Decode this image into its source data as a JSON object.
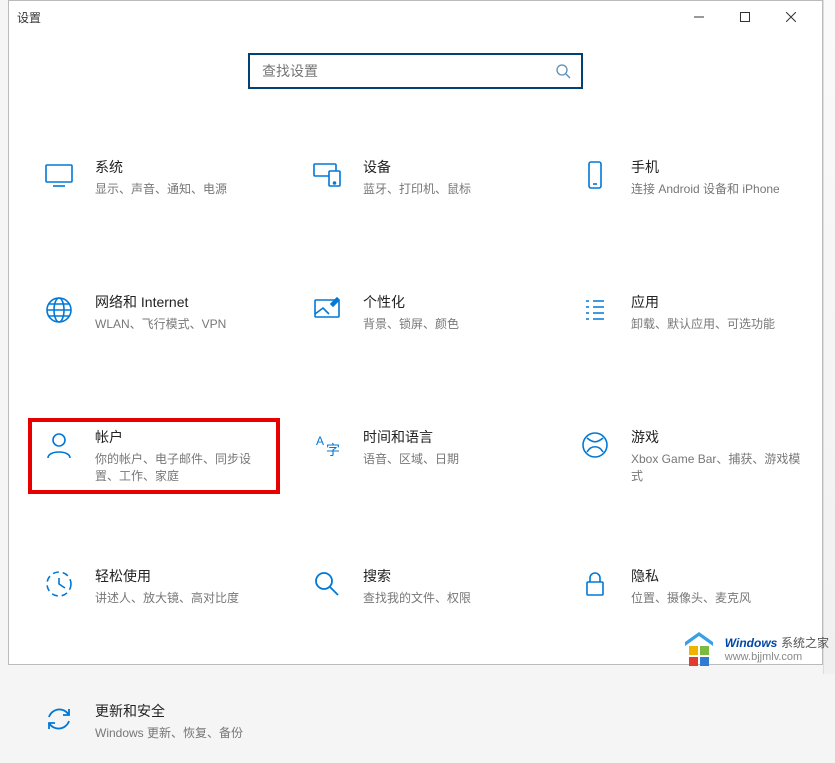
{
  "window": {
    "title": "设置"
  },
  "search": {
    "placeholder": "查找设置"
  },
  "tiles": [
    {
      "title": "系统",
      "desc": "显示、声音、通知、电源"
    },
    {
      "title": "设备",
      "desc": "蓝牙、打印机、鼠标"
    },
    {
      "title": "手机",
      "desc": "连接 Android 设备和 iPhone"
    },
    {
      "title": "网络和 Internet",
      "desc": "WLAN、飞行模式、VPN"
    },
    {
      "title": "个性化",
      "desc": "背景、锁屏、颜色"
    },
    {
      "title": "应用",
      "desc": "卸载、默认应用、可选功能"
    },
    {
      "title": "帐户",
      "desc": "你的帐户、电子邮件、同步设置、工作、家庭"
    },
    {
      "title": "时间和语言",
      "desc": "语音、区域、日期"
    },
    {
      "title": "游戏",
      "desc": "Xbox Game Bar、捕获、游戏模式"
    },
    {
      "title": "轻松使用",
      "desc": "讲述人、放大镜、高对比度"
    },
    {
      "title": "搜索",
      "desc": "查找我的文件、权限"
    },
    {
      "title": "隐私",
      "desc": "位置、摄像头、麦克风"
    },
    {
      "title": "更新和安全",
      "desc": "Windows 更新、恢复、备份"
    }
  ],
  "watermark": {
    "brand": "Windows",
    "brand_tail": "系统之家",
    "url": "www.bjjmlv.com"
  }
}
